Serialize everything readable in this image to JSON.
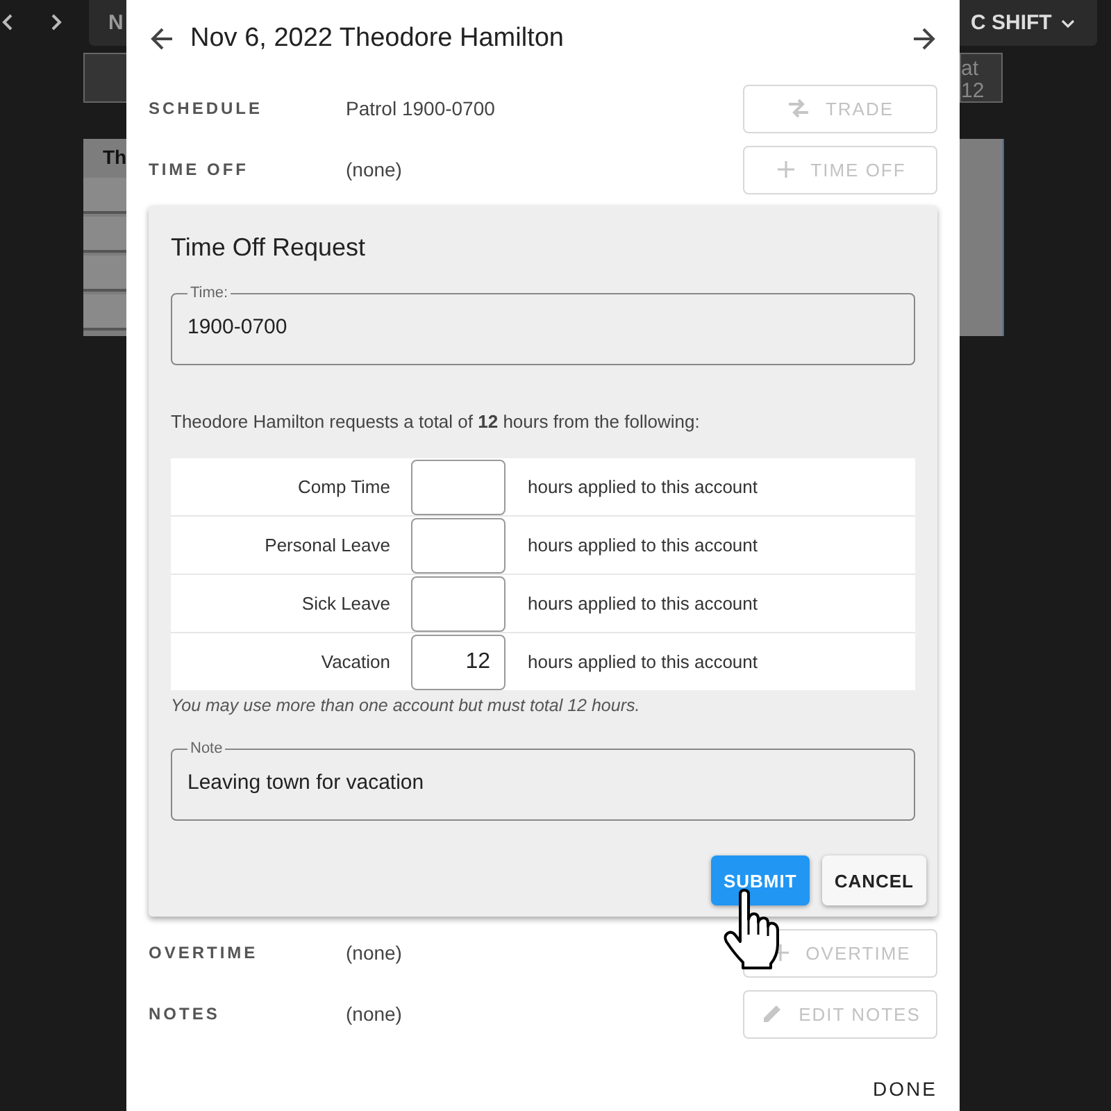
{
  "background": {
    "toolbar_label": "N",
    "shift_selector": "C SHIFT",
    "column_header": "Th",
    "day_header": [
      "at",
      "12"
    ]
  },
  "dialog": {
    "title": "Nov 6, 2022 Theodore Hamilton",
    "rows_before": [
      {
        "label": "SCHEDULE",
        "value": "Patrol 1900-0700",
        "action": {
          "label": "TRADE",
          "kind": "swap",
          "disabled": true
        }
      },
      {
        "label": "TIME OFF",
        "value": "(none)",
        "action": {
          "label": "TIME OFF",
          "kind": "plus",
          "disabled": true
        }
      }
    ],
    "request": {
      "title": "Time Off Request",
      "time": {
        "label": "Time:",
        "value": "1900-0700"
      },
      "summary": "Theodore Hamilton requests a total of **12** hours from the following:",
      "accounts": [
        {
          "name": "Comp Time",
          "suffix": "hours applied to this account"
        },
        {
          "name": "Personal Leave",
          "suffix": "hours applied to this account"
        },
        {
          "name": "Sick Leave",
          "suffix": "hours applied to this account"
        },
        {
          "name": "Vacation",
          "hours": "12",
          "suffix": "hours applied to this account"
        }
      ],
      "hint": "You may use more than one account but must total 12 hours.",
      "note": {
        "label": "Note",
        "value": "Leaving town for vacation"
      },
      "buttons": [
        {
          "label": "SUBMIT",
          "kind": "primary"
        },
        {
          "label": "CANCEL",
          "kind": "secondary"
        }
      ]
    },
    "rows_after": [
      {
        "label": "OVERTIME",
        "value": "(none)",
        "action": {
          "label": "OVERTIME",
          "kind": "plus",
          "disabled": true
        }
      },
      {
        "label": "NOTES",
        "value": "(none)",
        "action": {
          "label": "EDIT NOTES",
          "kind": "pencil",
          "disabled": true
        }
      }
    ],
    "done": "DONE"
  }
}
